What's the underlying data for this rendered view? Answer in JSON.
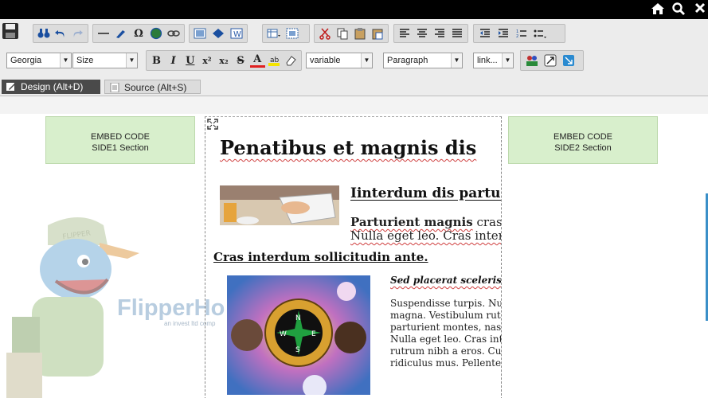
{
  "topbar": {
    "home_icon": "home-icon",
    "search_icon": "search-icon",
    "close_icon": "close-icon"
  },
  "toolbar": {
    "font_family": "Georgia",
    "font_size": "Size",
    "style_select": "variable",
    "format_select": "Paragraph",
    "link_select": "link...",
    "bold": "B",
    "italic": "I",
    "underline": "U",
    "superscript": "x²",
    "subscript": "x₂",
    "strike": "S",
    "font_color": "A",
    "omega": "Ω",
    "colors": {
      "toolbar_bg": "#ececec",
      "font_color_underline": "#e02020",
      "highlight": "#f4e400"
    }
  },
  "tabs": [
    {
      "label": "Design (Alt+D)",
      "active": true
    },
    {
      "label": "Source (Alt+S)",
      "active": false
    }
  ],
  "embed_left": {
    "line1": "EMBED CODE",
    "line2": "SIDE1 Section"
  },
  "embed_right": {
    "line1": "EMBED CODE",
    "line2": "SIDE2 Section"
  },
  "article": {
    "title": "Penatibus et magnis dis",
    "subheading": "Iinterdum dis partur",
    "para1_bold": "Parturient magnis",
    "para1_rest": " cras",
    "para1_line2": "Nulla eget leo. Cras interdu",
    "heading2": "Cras interdum sollicitudin ante.",
    "italic_sub": "Sed placerat scelerisq",
    "body_lines": "Suspendisse turpis. Null\nmagna. Vestibulum rut\nparturient montes, nasc\nNulla eget leo. Cras inte\nrutrum nibh a eros. Cur\nridiculus mus. Pellentes"
  },
  "watermark": {
    "brand": "FlipperHo",
    "tagline": "an invest ltd comp",
    "cap_text": "FLIPPER HOST"
  }
}
